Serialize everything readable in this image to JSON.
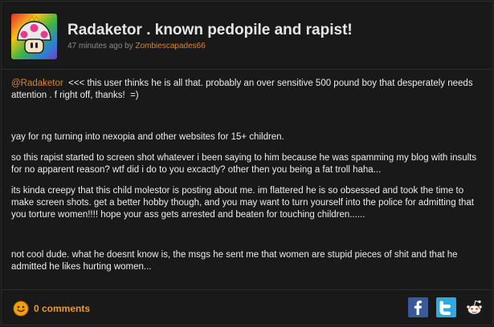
{
  "post": {
    "title": "Radaketor . known pedopile and rapist!",
    "time_ago": "47 minutes ago by ",
    "author": "Zombiescapades66"
  },
  "body": {
    "mention": "@Radaketor",
    "p1_rest": "  <<< this user thinks he is all that. probably an over sensitive 500 pound boy that desperately needs attention . f right off, thanks!  =)",
    "p2": "yay for ng turning into nexopia and other websites for 15+ children.",
    "p3": "so this rapist started to screen shot whatever i been saying to him because he was spamming my blog with insults for no apparent reason? wtf did i do to you excactly? other then you being a fat troll haha...",
    "p4": "its kinda creepy that this child molestor is posting about me. im flattered he is so obsessed and took the time to make screen shots. get a better hobby though, and you may want to turn yourself into the police for admitting that you torture women!!!! hope your ass gets arrested and beaten for touching children......",
    "p5": "not cool dude. what he doesnt know is, the msgs he sent me that women are stupid pieces of shit and that he admitted he likes hurting women..."
  },
  "footer": {
    "comments_label": "0 comments",
    "share": [
      "facebook",
      "twitter",
      "reddit"
    ]
  },
  "icons": {
    "avatar": "mushroom-icon",
    "comments": "smiley-icon"
  },
  "colors": {
    "accent": "#e3821b",
    "comments": "#f09a1a",
    "background": "#191919",
    "facebook": "#3b5998",
    "twitter": "#2fa9e0"
  }
}
